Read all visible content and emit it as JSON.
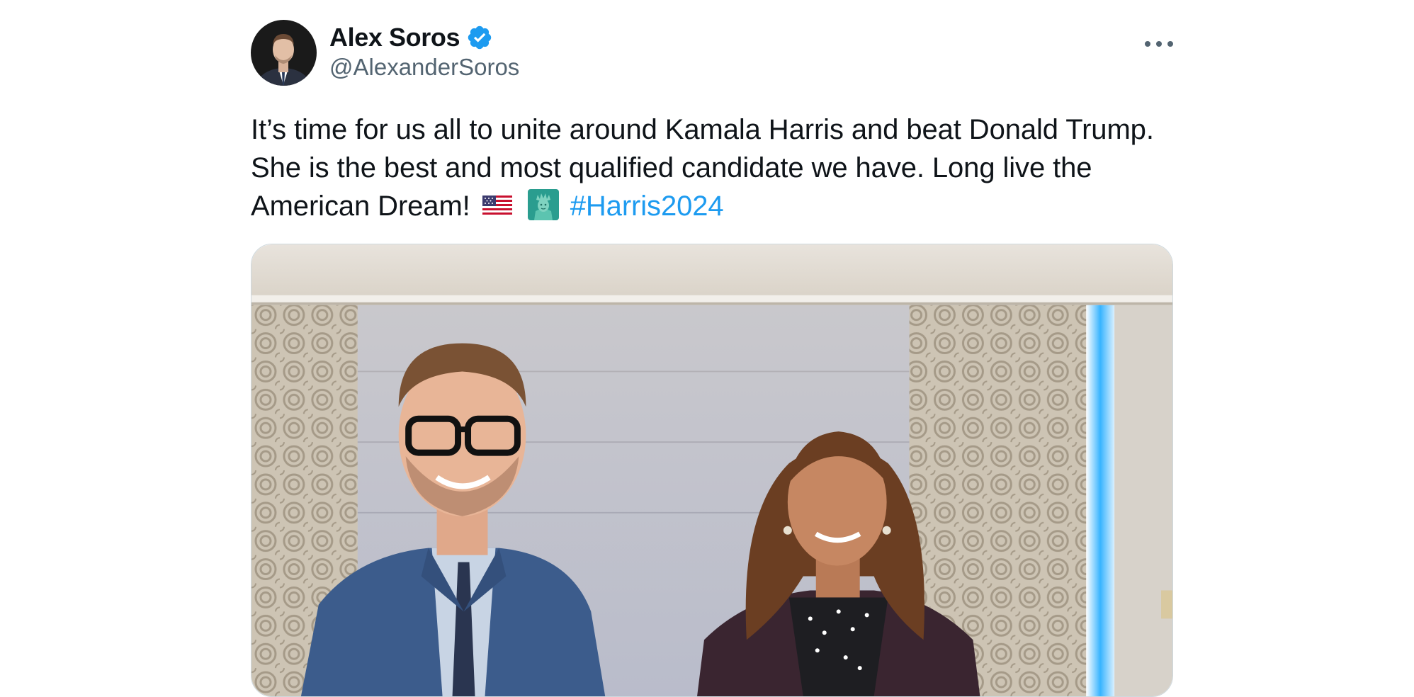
{
  "author": {
    "display_name": "Alex Soros",
    "handle": "@AlexanderSoros",
    "verified_icon": "verified-badge-icon",
    "verified_color": "#1d9bf0"
  },
  "menu": {
    "icon": "more-options-icon"
  },
  "tweet": {
    "text_line": "It’s time for us all to unite around Kamala Harris and beat Donald Trump. She is the best and most qualified candidate we have. Long live the American Dream!",
    "emoji_1": "us-flag-emoji",
    "emoji_2": "statue-of-liberty-emoji",
    "hashtag": "#Harris2024",
    "hashtag_color": "#1d9bf0"
  },
  "media": {
    "type": "photo"
  },
  "colors": {
    "text": "#0f1419",
    "secondary": "#536471",
    "border": "#cfd9de"
  }
}
